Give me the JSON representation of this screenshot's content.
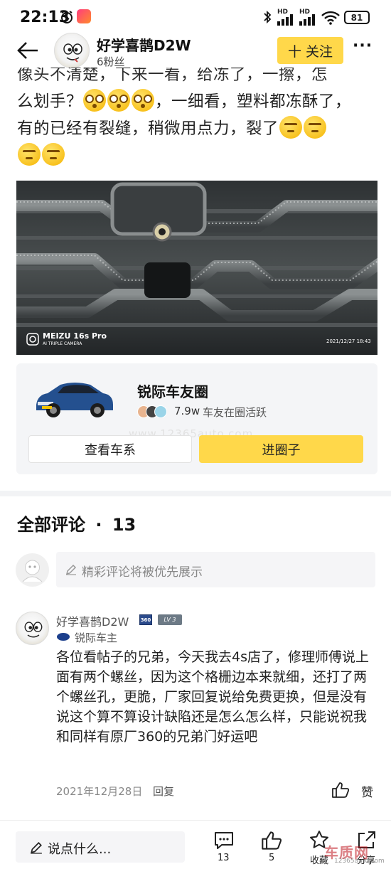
{
  "status_bar": {
    "time": "22:13",
    "network_1": "HD",
    "network_2": "HD",
    "battery": "81"
  },
  "header": {
    "author_name": "好学喜鹊D2W",
    "followers": "6粉丝",
    "follow_label": "十 关注",
    "more_label": "···"
  },
  "post": {
    "line1": "像头不清楚，下来一看，给冻了，一擦，怎",
    "line2": "么划手？",
    "line2b": "，一细看，塑料都冻酥了，",
    "line3": "有的已经有裂缝，稍微用点力，裂了",
    "photo": {
      "brand": "MEIZU 16s Pro",
      "brand_sub": "AI TRIPLE CAMERA",
      "timestamp": "2021/12/27  18:43"
    }
  },
  "circle_card": {
    "name": "锐际车友圈",
    "stats_count": "7.9w",
    "stats_label": "车友在圈活跃",
    "view_series_label": "查看车系",
    "join_label": "进圈子",
    "watermark": "www.12365auto.com"
  },
  "comments": {
    "title": "全部评论",
    "count": "13",
    "compose_placeholder": "精彩评论将被优先展示",
    "items": [
      {
        "author": "好学喜鹊D2W",
        "badge_360": "360",
        "badge_level": "LV 3",
        "role": "锐际车主",
        "text": "各位看帖子的兄弟，今天我去4s店了，修理师傅说上面有两个螺丝，因为这个格栅边本来就细，还打了两个螺丝孔，更脆，厂家回复说给免费更换，但是没有说这个算不算设计缺陷还是怎么怎么样，只能说祝我和同样有原厂360的兄弟门好运吧",
        "date": "2021年12月28日",
        "reply_label": "回复",
        "like_label": "赞"
      }
    ]
  },
  "bottom_bar": {
    "say_placeholder": "说点什么...",
    "comment_count": "13",
    "like_count": "5",
    "collect_label": "收藏",
    "share_label": "分享",
    "watermark_main": "车质网",
    "watermark_url": "12365auto.com"
  },
  "colors": {
    "accent_yellow": "#ffd84a",
    "text_dark": "#222222",
    "text_gray": "#888888",
    "card_bg": "#f4f5f7"
  }
}
